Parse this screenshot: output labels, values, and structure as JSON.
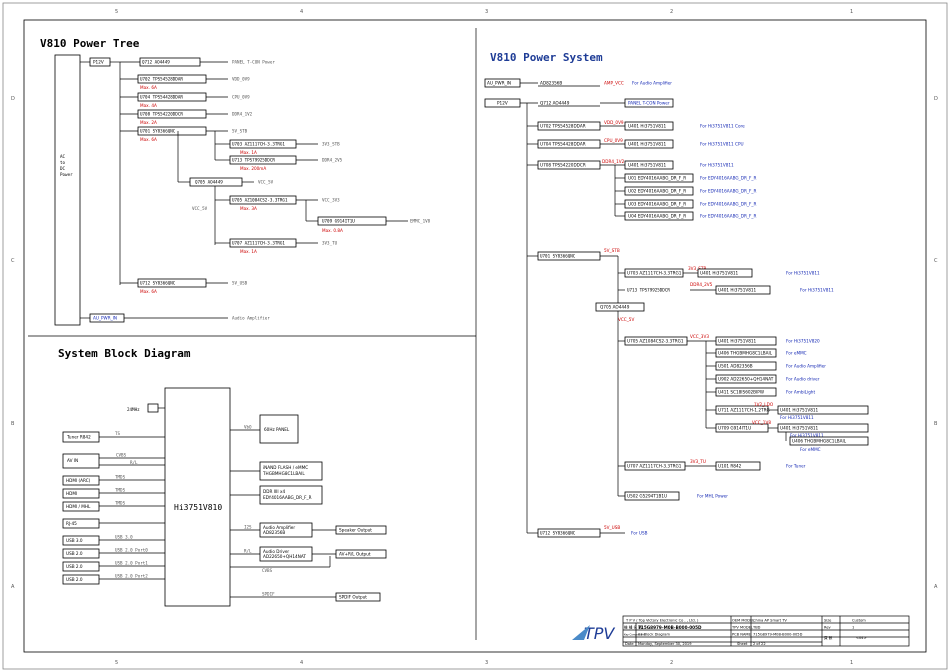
{
  "frame": {
    "cols": [
      "1",
      "2",
      "3",
      "4",
      "5"
    ],
    "rows": [
      "A",
      "B",
      "C",
      "D"
    ]
  },
  "power_tree": {
    "title": "V810 Power Tree",
    "source_label": [
      "AC",
      "to",
      "DC",
      "Power"
    ],
    "p12v": "P12V",
    "q712": "Q712 AO4449",
    "panel": "PANEL T-CON Power",
    "u702": "U702 TPS54528DDAR",
    "vdd": "VDD_0V9",
    "u702_max": "Max. 6A",
    "u704": "U704 TPS54428DDAR",
    "cpu": "CPU_0V9",
    "u704_max": "Max. 4A",
    "u708": "U708 TPS54220DDCR",
    "ddr": "DDR4_1V2",
    "u708_max": "Max. 2A",
    "u701": "U701 SY8366QNC",
    "v5stb": "5V_STB",
    "u701_max": "Max. 6A",
    "u703": "U703 AZ1117CH-3.3TRG1",
    "v3stb": "3V3_STB",
    "u703_max": "Max. 1A",
    "u713": "U713 TPS79925DDCR",
    "ddr4_2v5": "DDR4_2V5",
    "u713_max": "Max. 200mA",
    "q705": "Q705 AO4449",
    "vcc5v": "VCC_5V",
    "vcc5v_side": "VCC_5V",
    "u705": "U705 AZ1084CS2-3.3TRG1",
    "vcc3v3": "VCC_3V3",
    "u705_max": "Max. 3A",
    "u709": "U709 G914IT1U",
    "emmc": "EMMC_1V8",
    "u709_max": "Max. 0.8A",
    "u707": "U707 AZ1117CH-3.3TRG1",
    "v3tu": "3V3_TU",
    "u707_max": "Max. 1A",
    "u712": "U712 SY8366QNC",
    "v5usb": "5V_USB",
    "u712_max": "Max. 6A",
    "au_pwr": "AU_PWR_IN",
    "audio_amp": "Audio Amplifier"
  },
  "power_system": {
    "title": "V810 Power System",
    "au_pwr": "AU_PWR_IN",
    "ad8356b": "AD82356B",
    "amp_vcc": "AMP_VCC",
    "for_amp": "For Audio Amplifier",
    "p12v": "P12V",
    "q712": "Q712 AO4449",
    "panel": "PANEL T-CON Power",
    "u702": "U702 TPS54528DDAR",
    "vdd": "VDD_0V9",
    "u401a": "U401 Hi3751V811",
    "for_core": "For Hi3751V811 Core",
    "u704": "U704 TPS54428DDAR",
    "cpu": "CPU_0V9",
    "u401b": "U401 Hi3751V811",
    "for_cpu": "For Hi3751V811 CPU",
    "u708": "U708 TPS54220DDCR",
    "ddr": "DDR4_1V2",
    "u401c": "U401 Hi3751V811",
    "for_v811": "For Hi3751V811",
    "u01": "U01 EDY4016AABG_DR_F_R",
    "u02": "U02 EDY4016AABG_DR_F_R",
    "u03": "U03 EDY4016AABG_DR_F_R",
    "u04": "U04 EDY4016AABG_DR_F_R",
    "for_ddr": "For EDY4016AABG_DR_F_R",
    "u701": "U701 SY8366QNC",
    "v5stb": "5V_STB",
    "u703": "U703 AZ1117CH-3.3TRG1",
    "v3stb": "3V3_STB",
    "u401d": "U401 Hi3751V811",
    "for_v811b": "For Hi3751V811",
    "u713": "U713 TPS79925DDCR",
    "ddr4_2v5": "DDR4_2V5",
    "u401e": "U401 Hi3751V811",
    "for_v811c": "For Hi3751V811",
    "q705": "Q705 AO4449",
    "vcc5v": "VCC_5V",
    "u705": "U705 AZ1084CS2-3.3TRG1",
    "vcc3v3": "VCC_3V3",
    "u401f": "U401 Hi3751V811",
    "for_v810": "For Hi3751V820",
    "u406": "U406 THGBMHG8C1LBAIL",
    "for_emmc": "For eMMC",
    "u501": "U501 AD82356B",
    "for_amp2": "For Audio Amplifier",
    "u902": "U902 AD22650+QH14NAT",
    "for_drv": "For Audio driver",
    "u411": "U411 SC18IS602BIPW",
    "for_amb": "For AmbiLight",
    "u711": "U711 AZ1117CH-1.2TRG",
    "v1v2ldo": "1V2_LDO",
    "u401g": "U401 Hi3751V811",
    "for_v811d": "For Hi3751V811",
    "u709": "U709 G914IT1U",
    "vcc1v8": "VCC_1V8",
    "u401h": "U401 Hi3751V811",
    "for_v811e": "For Hi3751V811",
    "u406b": "U406 THGBMHG8C1LBAIL",
    "for_emmc2": "For eMMC",
    "u707": "U707 AZ1117CH-3.3TRG1",
    "v3tu": "3V3_TU",
    "u101": "U101 R842",
    "for_tuner": "For Tuner",
    "u502": "U502 G5294T1B1U",
    "for_mhl": "For MHL Power",
    "u712": "U712 SY8366QNC",
    "v5usb": "5V_USB",
    "for_usb": "For USB"
  },
  "block": {
    "title": "System Block Diagram",
    "soc": "Hi3751V810",
    "crystal": "24MHz",
    "tuner": "Tuner R842",
    "tuner_sig": "TS",
    "av_in": "AV IN",
    "av_sig1": "CVBS",
    "av_sig2": "R/L",
    "hdmi1": "HDMI (ARC)",
    "hdmi2": "HDMI",
    "hdmi3": "HDMI / MHL",
    "tmds": "TMDS",
    "rj45": "RJ-45",
    "usb30": "USB 3.0",
    "usb20a": "USB 2.0",
    "usb20b": "USB 2.0",
    "usb20c": "USB 2.0",
    "usb_sig1": "USB 3.0",
    "usb_sig2": "USB 2.0 Port0",
    "usb_sig3": "USB 2.0 Port1",
    "usb_sig4": "USB 2.0 Port2",
    "panel": "60Hz PANEL",
    "vbo": "VbO",
    "flash": [
      "iNAND FLASH / eMMC",
      "THGBMHG8C1LBAIL"
    ],
    "ddr": [
      "DDR IIII x4",
      "EDY4016AABG_DR_F_R"
    ],
    "amp": [
      "Audio Amplifier",
      "AD82356B"
    ],
    "speaker": "Speaker Output",
    "i2s": "I2S",
    "driver": [
      "Audio Driver",
      "AD22650+QH14NAT"
    ],
    "av_out": "AV+R/L Output",
    "rl": "R/L",
    "cvbs": "CVBS",
    "spdif": "SPDIF Output",
    "spdif_sig": "SPDIF"
  },
  "title_block": {
    "company": "T P V  ( Top  Victory  Electronic  Co . , Ltd. )",
    "logo": "TPV",
    "oem_model_label": "OEM MODEL",
    "oem_model": "China AP Smart TV",
    "size_label": "Size",
    "size": "Custom",
    "part_label": "機 種 名 稱",
    "part": "715G8979-M0B-B000-005D",
    "tpv_model_label": "TPV MODEL",
    "tpv_model": "TBD",
    "rev_label": "Rev",
    "rev": "1",
    "key_label": "Key Component",
    "key": "03 Block Diagram",
    "pcb_label": "PCB NAME",
    "pcb": "715G8979-M0B-B000-005D",
    "page_label": "頁 數",
    "page": "<04>",
    "date_label": "Date",
    "date": "Monday, September 30, 2019",
    "sheet_label": "Sheet",
    "sheet": "2     of     22"
  }
}
